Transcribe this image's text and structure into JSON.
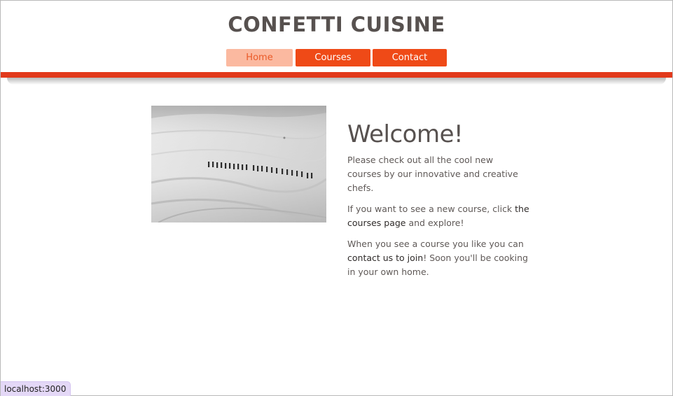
{
  "site": {
    "title": "CONFETTI CUISINE"
  },
  "nav": {
    "items": [
      {
        "label": "Home",
        "active": true
      },
      {
        "label": "Courses",
        "active": false
      },
      {
        "label": "Contact",
        "active": false
      }
    ]
  },
  "main": {
    "heading": "Welcome!",
    "para1": "Please check out all the cool new courses by our innovative and creative chefs.",
    "para2_before": "If you want to see a new course, click ",
    "para2_link": "the courses page",
    "para2_after": " and explore!",
    "para3_before": "When you see a course you like you can ",
    "para3_link": "contact us to join",
    "para3_after": "! Soon you'll be cooking in your own home.",
    "image": {
      "subject": "hikers crossing a snowfield",
      "style": "black-and-white photo"
    }
  },
  "status_bar": {
    "url": "localhost:3000"
  },
  "colors": {
    "brand_orange": "#ef4a17",
    "accent_bar": "#e2391b",
    "nav_active_bg": "#fbb9a0",
    "title_text": "#57514f",
    "status_bg": "#e4d8f7"
  }
}
